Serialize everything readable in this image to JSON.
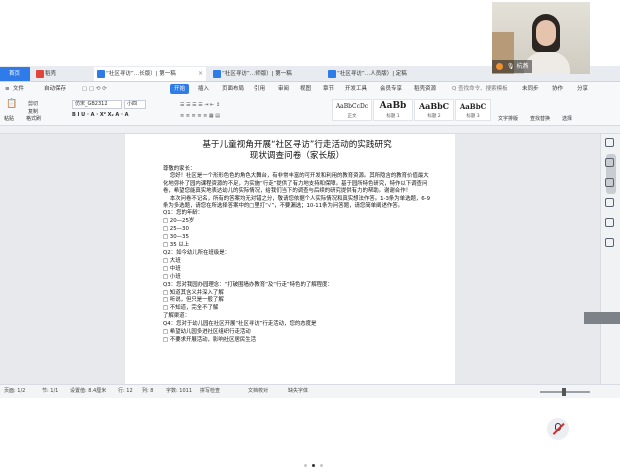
{
  "video": {
    "participant_name": "杭燕"
  },
  "tabs": [
    {
      "label": "首页"
    },
    {
      "label": "稻壳"
    },
    {
      "label": "“社区寻访”…长版）| 第一稿"
    },
    {
      "label": "“社区寻访”…师版）| 第一稿"
    },
    {
      "label": "“社区寻访”…人员版）| 定稿"
    }
  ],
  "menu": {
    "file": "文件",
    "autosave": "自动保存",
    "start": "开始",
    "items": [
      "插入",
      "页面布局",
      "引用",
      "审阅",
      "视图",
      "章节",
      "开发工具",
      "会员专享",
      "稻壳资源"
    ],
    "search": "Q 查找命令、搜索模板",
    "not_synced": "未同步",
    "collab": "协作",
    "share": "分享"
  },
  "ribbon": {
    "paste": "粘贴",
    "format_painter": "格式刷",
    "cut": "剪切",
    "copy": "复制",
    "font_name": "仿宋_GB2312",
    "font_size": "小四",
    "styles": [
      {
        "sample": "AaBbCcDc",
        "label": "正文"
      },
      {
        "sample": "AaBb",
        "label": "标题 1"
      },
      {
        "sample": "AaBbC",
        "label": "标题 2"
      },
      {
        "sample": "AaBbC",
        "label": "标题 3"
      }
    ],
    "text_tools": "文字排版",
    "find_replace": "查找替换",
    "select": "选择"
  },
  "document": {
    "title_line1": "基于儿童视角开展“社区寻访”行走活动的实践研究",
    "title_line2": "现状调查问卷（家长版）",
    "greeting": "尊敬的家长：",
    "intro": "    您好！社区是一个形形色色的角色大舞台，有非常丰富的可开发和利用的教育资源。其所隐含的教育价值最大化地弥补了园内课程资源的不足，为实施“行走”提供了有力地支持和保障。基于园所特色研究，特作以下调查问卷，希望您能真实地表达幼儿的实际情况，给我们当下的调查与后续的研究提供有力的帮助。谢谢合作！\n    本次问卷不记名，所有的答案均无对错之分，敬请您依据个人实际情况和真实想法作答。1-3条为单选题，6-9条为多选题，请您在所选择答案中的□里打“√”，不要漏选；10-11条为问答题，请您简单阐述作答。",
    "lines": [
      "Q1：您的年龄：",
      "□ 20—25岁",
      "□ 25—30",
      "□ 30—35",
      "□ 35 以上",
      "Q2：如今幼儿所在班级是：",
      "□ 大班",
      "□ 中班",
      "□ 小班",
      "Q3：您对我园办园理念：“打破围墙办教育”及“行走”特色的了解程度：",
      "□ 知道其含义并深入了解",
      "□ 听说，但只是一般了解",
      "□ 不知道，完全不了解",
      "了解渠道：",
      "Q4：您对于幼儿园在社区开展“社区寻访”行走活动，您的态度是",
      "□ 希望幼儿园多进社区组织行走活动",
      "□ 不要求开展活动，影响社区居民生活"
    ]
  },
  "status": {
    "page": "页面: 1/2",
    "section": "节: 1/1",
    "setting": "设置值: 8.4厘米",
    "row": "行: 12",
    "col": "列: 8",
    "word_count": "字数: 1011",
    "spellcheck": "拼写检查",
    "doc_check": "文档校对",
    "missing_font": "缺失字体"
  },
  "pager": {
    "current": 2,
    "total": 3
  }
}
